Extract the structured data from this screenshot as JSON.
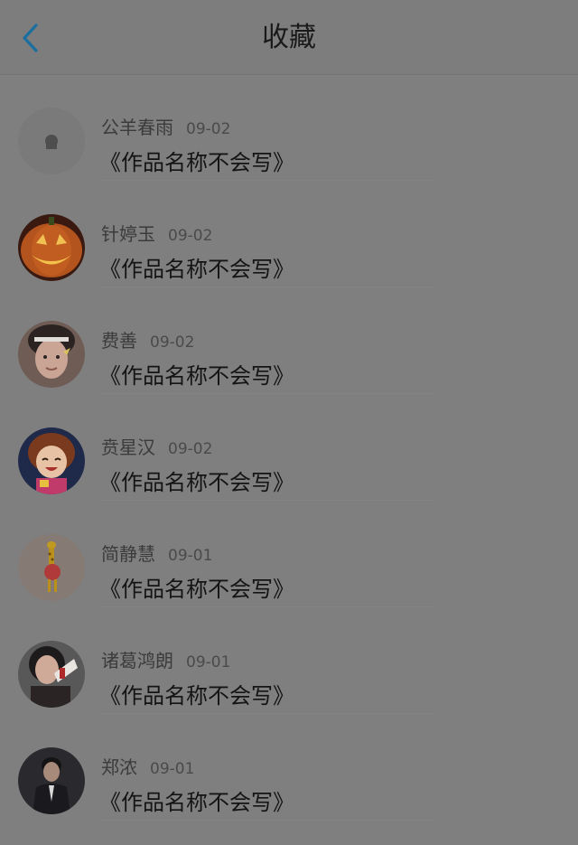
{
  "header": {
    "title": "收藏",
    "back_icon": "chevron-left-icon",
    "back_color": "#1a6fa0"
  },
  "items": [
    {
      "name": "公羊春雨",
      "date": "09-02",
      "work": "《作品名称不会写》",
      "avatar": "blank-avatar"
    },
    {
      "name": "针婷玉",
      "date": "09-02",
      "work": "《作品名称不会写》",
      "avatar": "pumpkin-avatar"
    },
    {
      "name": "费善",
      "date": "09-02",
      "work": "《作品名称不会写》",
      "avatar": "person-avatar"
    },
    {
      "name": "贲星汉",
      "date": "09-02",
      "work": "《作品名称不会写》",
      "avatar": "anime-girl-avatar"
    },
    {
      "name": "简静慧",
      "date": "09-01",
      "work": "《作品名称不会写》",
      "avatar": "giraffe-avatar"
    },
    {
      "name": "诸葛鸿朗",
      "date": "09-01",
      "work": "《作品名称不会写》",
      "avatar": "woman-avatar"
    },
    {
      "name": "郑浓",
      "date": "09-01",
      "work": "《作品名称不会写》",
      "avatar": "man-suit-avatar"
    }
  ]
}
